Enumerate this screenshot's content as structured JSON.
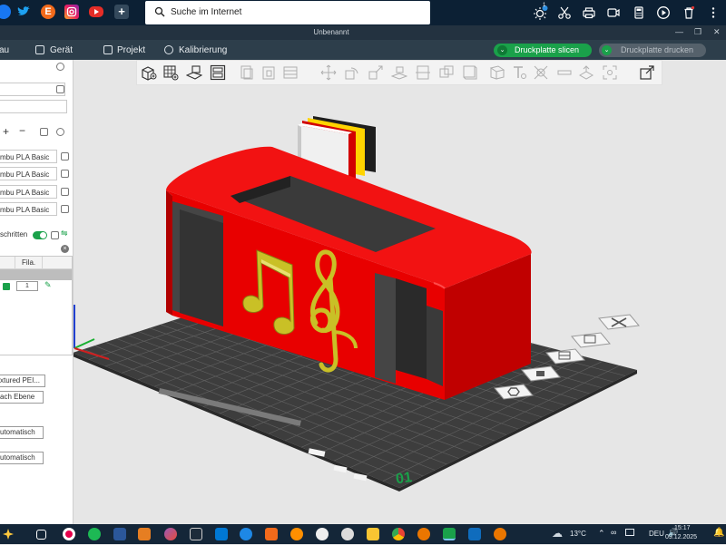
{
  "browser": {
    "search_placeholder": "Suche im Internet",
    "quicklinks": [
      "facebook-icon",
      "twitter-icon",
      "e-icon",
      "instagram-icon",
      "youtube-icon",
      "add-icon"
    ],
    "e_label": "E",
    "add_label": "+",
    "notification_count": "1"
  },
  "window": {
    "title": "Unbenannt"
  },
  "menu": {
    "items": [
      "au",
      "Gerät",
      "Projekt",
      "Kalibrierung"
    ],
    "slice_label": "Druckplatte slicen",
    "print_label": "Druckplatte drucken"
  },
  "colors": {
    "accent": "#1aa14a",
    "model": "#e30000",
    "plate": "#3c3c3c",
    "grid": "#6a6a6a"
  },
  "left_panel": {
    "filaments": [
      "mbu PLA Basic",
      "mbu PLA Basic",
      "mbu PLA Basic",
      "mbu PLA Basic"
    ],
    "plus_label": "+",
    "minus_label": "−",
    "steps_label": "schritten",
    "column_header": "Fila.",
    "filament_index": "1",
    "plate_type": "xtured PEI...",
    "seam_label": "ach Ebene",
    "auto_1": "utomatisch",
    "auto_2": "utomatisch"
  },
  "plate": {
    "number": "01"
  },
  "taskbar": {
    "temperature": "13°C",
    "language": "DEU",
    "time": "15:17",
    "date": "09.12.2025"
  }
}
